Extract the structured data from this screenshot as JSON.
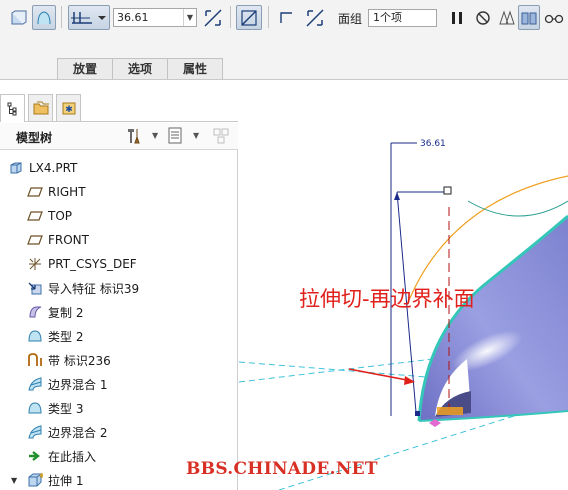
{
  "dashboard": {
    "depth_value": "36.61",
    "face_group_label": "面组",
    "face_group_value": "1个项",
    "tabs": [
      {
        "label": "放置"
      },
      {
        "label": "选项"
      },
      {
        "label": "属性"
      }
    ]
  },
  "navigator": {
    "tree_title": "模型树",
    "tabs": [
      "model-tree",
      "folder-browser",
      "favorites"
    ]
  },
  "tree": {
    "items": [
      {
        "label": "LX4.PRT",
        "icon": "part-icon"
      },
      {
        "label": "RIGHT",
        "icon": "datum-plane-icon"
      },
      {
        "label": "TOP",
        "icon": "datum-plane-icon"
      },
      {
        "label": "FRONT",
        "icon": "datum-plane-icon"
      },
      {
        "label": "PRT_CSYS_DEF",
        "icon": "csys-icon"
      },
      {
        "label": "导入特征 标识39",
        "icon": "import-feature-icon"
      },
      {
        "label": "复制 2",
        "icon": "copy-icon"
      },
      {
        "label": "类型 2",
        "icon": "surface-icon"
      },
      {
        "label": "带 标识236",
        "icon": "ribbon-icon"
      },
      {
        "label": "边界混合 1",
        "icon": "boundary-blend-icon"
      },
      {
        "label": "类型 3",
        "icon": "surface-icon"
      },
      {
        "label": "边界混合 2",
        "icon": "boundary-blend-icon"
      },
      {
        "label": "在此插入",
        "icon": "insert-here-icon"
      },
      {
        "label": "拉伸 1",
        "icon": "extrude-icon"
      }
    ]
  },
  "graphics": {
    "dimension_label": "36.61",
    "annotation": "拉伸切-再边界补面",
    "watermark": "BBS.CHINADE.NET"
  },
  "colors": {
    "annotation": "#e0201a",
    "surface_fill": "#8d91d8",
    "edge_highlight": "#34c6b8",
    "dimension": "#1a2a8a",
    "datum_dash": "#3ec3d9"
  }
}
